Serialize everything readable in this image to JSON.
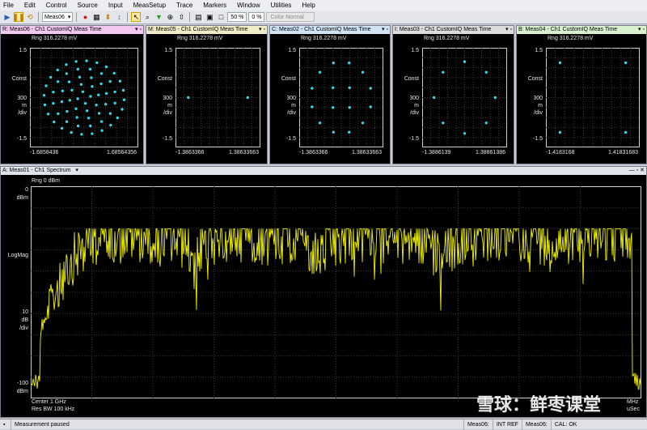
{
  "menu": [
    "File",
    "Edit",
    "Control",
    "Source",
    "Input",
    "MeasSetup",
    "Trace",
    "Markers",
    "Window",
    "Utilities",
    "Help"
  ],
  "toolbar": {
    "meas_select": "Meas06",
    "zoom1": "50 %",
    "zoom2": "0 %",
    "color_mode": "Color Normal"
  },
  "const_windows": [
    {
      "title": "R: Meas06 - Ch1 CustomIQ Meas Time",
      "title_bg": "#f2c8f0",
      "rng": "Rng 316.2278 mV",
      "y_top": "1.5",
      "y_mid1": "Const",
      "y_mid2": "300",
      "y_mid3": "m",
      "y_mid4": "/div",
      "y_bot": "-1.5",
      "x_left": "-1.6858436",
      "x_right": "1.68564356",
      "pattern": "64qam"
    },
    {
      "title": "M: Meas05 - Ch1 CustomIQ Meas Time",
      "title_bg": "#f0ecc8",
      "rng": "Rng 316.2278 mV",
      "y_top": "1.5",
      "y_mid1": "Const",
      "y_mid2": "300",
      "y_mid3": "m",
      "y_mid4": "/div",
      "y_bot": "-1.5",
      "x_left": "-1.3863366",
      "x_right": "1.38633663",
      "pattern": "bpsk"
    },
    {
      "title": "C: Meas02 - Ch1 CustomIQ Meas Time",
      "title_bg": "#cfe4f5",
      "rng": "Rng 316.2278 mV",
      "y_top": "1.5",
      "y_mid1": "Const",
      "y_mid2": "300",
      "y_mid3": "m",
      "y_mid4": "/div",
      "y_bot": "-1.5",
      "x_left": "-1.3863366",
      "x_right": "1.38633663",
      "pattern": "16apsk"
    },
    {
      "title": "I: Meas03 - Ch1 CustomIQ Meas Time",
      "title_bg": "#dcdcdc",
      "rng": "Rng 316.2278 mV",
      "y_top": "1.5",
      "y_mid1": "Const",
      "y_mid2": "300",
      "y_mid3": "m",
      "y_mid4": "/div",
      "y_bot": "-1.5",
      "x_left": "-1.3886139",
      "x_right": "1.38861386",
      "pattern": "8psk"
    },
    {
      "title": "B: Meas04 - Ch1 CustomIQ Meas Time",
      "title_bg": "#d8f2d0",
      "rng": "Rng 316.2278 mV",
      "y_top": "1.5",
      "y_mid1": "Const",
      "y_mid2": "300",
      "y_mid3": "m",
      "y_mid4": "/div",
      "y_bot": "-1.5",
      "x_left": "-1.4183168",
      "x_right": "1.41831683",
      "pattern": "qpsk"
    }
  ],
  "spectrum": {
    "title": "A: Meas01 - Ch1 Spectrum",
    "rng": "Rng 0 dBm",
    "y_top": "0",
    "y_top_unit": "dBm",
    "y_mid": "LogMag",
    "y_scale1": "10",
    "y_scale2": "dB",
    "y_scale3": "/div",
    "y_bot": "-100",
    "y_bot_unit": "dBm",
    "center": "Center 1 GHz",
    "resbw": "Res BW 100 kHz",
    "span_right": "MHz",
    "time_right": "uSec",
    "trace_color": "#f2f200"
  },
  "watermark": "雪球：鲜枣课堂",
  "status": {
    "message": "Measurement paused",
    "meas06_a": "Meas06:",
    "intref": "INT REF",
    "meas06_b": "Meas06:",
    "cal": "CAL: OK"
  }
}
